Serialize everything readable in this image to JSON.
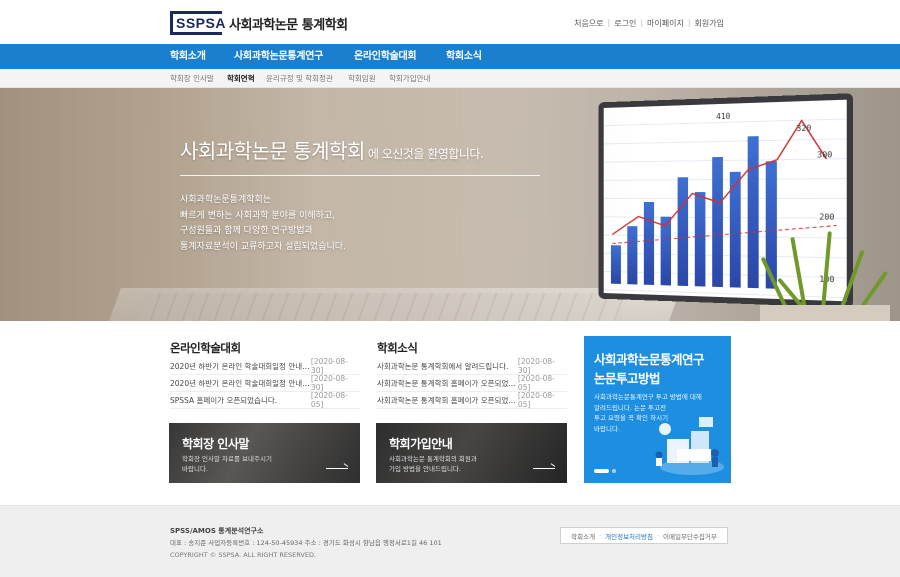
{
  "header": {
    "logo_text": "SSPSA",
    "site_title": "사회과학논문 통계학회",
    "util_links": [
      "처음으로",
      "로그인",
      "마이페이지",
      "회원가입"
    ]
  },
  "gnb": {
    "items": [
      "학회소개",
      "사회과학논문통계연구",
      "온라인학술대회",
      "학회소식"
    ]
  },
  "subnav": {
    "items": [
      "학회장 인사말",
      "학회연혁",
      "윤리규정 및 학회정관",
      "학회임원",
      "학회가입안내"
    ],
    "active_index": 1
  },
  "hero": {
    "title_main": "사회과학논문 통계학회",
    "title_tail": "에 오신것을 환영합니다.",
    "desc_lines": [
      "사회과학논문통계학회는",
      "빠르게 변하는 사회과학 분야를 이해하고,",
      "구성원들과 함께 다양한 연구방법과",
      "통계자료분석이 교류하고자 설립되었습니다."
    ],
    "screen_numbers": [
      "410",
      "320",
      "300",
      "200",
      "100"
    ]
  },
  "online_conference": {
    "title": "온라인학술대회",
    "items": [
      {
        "title": "2020년 하반기 온라인 학술대회일정 안내드...",
        "date": "[2020-08-30]"
      },
      {
        "title": "2020년 하반기 온라인 학술대회일정 안내드...",
        "date": "[2020-08-30]"
      },
      {
        "title": "SPSSA 홈페이가 오픈되었습니다.",
        "date": "[2020-08-05]"
      }
    ]
  },
  "news": {
    "title": "학회소식",
    "items": [
      {
        "title": "사회과학논문 통계학회에서 알려드립니다.",
        "date": "[2020-08-30]"
      },
      {
        "title": "사회과학논문 통계학회 홈페이가 오픈되었...",
        "date": "[2020-08-05]"
      },
      {
        "title": "사회과학논문 통계학회 홈페이가 오픈되었...",
        "date": "[2020-08-05]"
      }
    ]
  },
  "cards": {
    "greeting": {
      "title": "학회장 인사말",
      "desc_lines": [
        "학회장 인사말 자료를 보내주시기",
        "바랍니다."
      ]
    },
    "join": {
      "title": "학회가입안내",
      "desc_lines": [
        "사회과학논문 통계학회의 회원과",
        "가입 방법을 안내드립니다."
      ]
    }
  },
  "banner": {
    "title_lines": [
      "사회과학논문통계연구",
      "논문투고방법"
    ],
    "desc_lines": [
      "사회과학논문통계연구 투고 방법에 대해",
      "알려드립니다. 논문 투고전",
      "투고 요령을 꼭 확인 하시기",
      "바랍니다."
    ],
    "color": "#1e8fe0"
  },
  "footer": {
    "org_name": "SPSS/AMOS 통계분석연구소",
    "info": "대표 : 송지준    사업자등록번호 : 124-50-45934    주소 : 경기도 화성시 향남읍 행정서로1길 46 101",
    "copyright": "COPYRIGHT © SSPSA. ALL RIGHT RESERVED.",
    "links": [
      "학회소개",
      "개인정보처리방침",
      "이메일무단수집거부"
    ]
  },
  "colors": {
    "primary_blue": "#1b7fd0",
    "logo_navy": "#1a2a5a"
  }
}
